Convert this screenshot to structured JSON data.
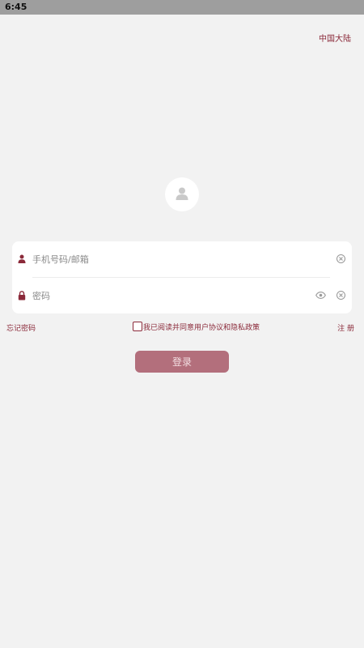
{
  "status_bar": {
    "time": "6:45"
  },
  "header": {
    "region_label": "中国大陆"
  },
  "avatar": {
    "icon": "user-icon"
  },
  "form": {
    "account": {
      "placeholder": "手机号码/邮箱",
      "value": "",
      "icon": "user-icon"
    },
    "password": {
      "placeholder": "密码",
      "value": "",
      "icon": "lock-icon"
    }
  },
  "links": {
    "forgot_password": "忘记密码",
    "agreement": "我已阅读并同意用户协议和隐私政策",
    "register": "注 册"
  },
  "login_button": {
    "label": "登录"
  },
  "colors": {
    "accent": "#8b2a3a",
    "button_bg": "#b36f7c",
    "page_bg": "#f2f2f2",
    "status_bar_bg": "#9e9e9e"
  }
}
